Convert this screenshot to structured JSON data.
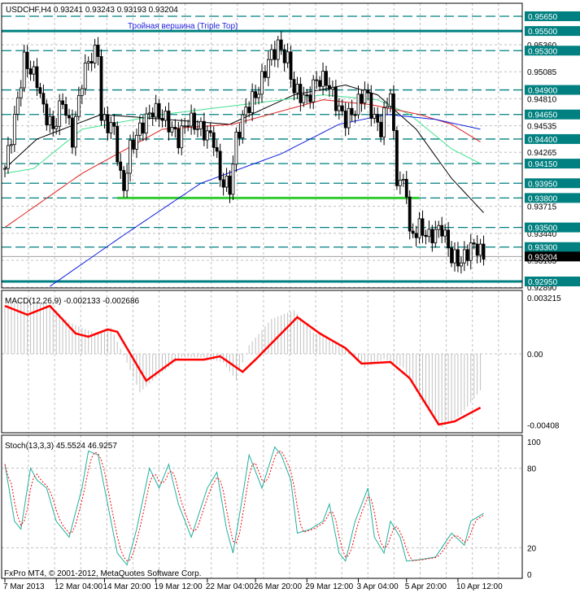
{
  "header": {
    "symbol_info": "USDCHF,H4  0.93241 0.93243 0.93193 0.93204",
    "pattern_label": "Тройная вершина (Triple Top)"
  },
  "colors": {
    "level": "#008080",
    "support": "#33cc33",
    "ma_black": "#000000",
    "ma_red": "#e02020",
    "ma_blue": "#1020e0",
    "ma_green": "#40e090",
    "macd_signal": "#ff0000",
    "macd_hist": "#c0c0c0",
    "stoch_main": "#20b0a0",
    "stoch_signal": "#ff0000"
  },
  "footer": {
    "copyright": "FxPro MT4, © 2001-2012, MetaQuotes Software Corp."
  },
  "chart_data": [
    {
      "type": "candlestick",
      "title": "USDCHF,H4",
      "ylim": [
        0.9287,
        0.9578
      ],
      "x_tick_labels": [
        "7 Mar 2013",
        "12 Mar 04:00",
        "14 Mar 20:00",
        "19 Mar 12:00",
        "22 Mar 04:00",
        "26 Mar 20:00",
        "29 Mar 12:00",
        "3 Apr 04:00",
        "5 Apr 20:00",
        "10 Apr 12:00"
      ],
      "x_tick_bars": [
        0,
        16,
        31,
        47,
        63,
        78,
        94,
        110,
        125,
        141
      ],
      "y_tick_labels": [
        "0.95360",
        "0.95085",
        "0.94810",
        "0.94535",
        "0.94265",
        "0.93715",
        "0.93440",
        "0.93165",
        "0.92890"
      ],
      "levels": [
        {
          "label": "0.95650",
          "price": 0.9565,
          "style": "dashed"
        },
        {
          "label": "0.95500",
          "price": 0.955,
          "style": "solid"
        },
        {
          "label": "0.95300",
          "price": 0.953,
          "style": "dashed"
        },
        {
          "label": "0.94900",
          "price": 0.949,
          "style": "dashed"
        },
        {
          "label": "0.94650",
          "price": 0.9465,
          "style": "dashed"
        },
        {
          "label": "0.94400",
          "price": 0.944,
          "style": "dashed"
        },
        {
          "label": "0.94150",
          "price": 0.9415,
          "style": "dashed"
        },
        {
          "label": "0.93950",
          "price": 0.9395,
          "style": "dashed"
        },
        {
          "label": "0.93800",
          "price": 0.938,
          "style": "dashed"
        },
        {
          "label": "0.93500",
          "price": 0.935,
          "style": "dashed"
        },
        {
          "label": "0.93300",
          "price": 0.933,
          "style": "dashed"
        },
        {
          "label": "0.92950",
          "price": 0.9295,
          "style": "solid"
        }
      ],
      "support_line": {
        "price": 0.938,
        "from_bar": 35,
        "to_bar": 129
      },
      "current_price": {
        "label": "0.93204",
        "price": 0.93204
      },
      "close_path": [
        [
          0,
          0.941
        ],
        [
          3,
          0.946
        ],
        [
          6,
          0.952
        ],
        [
          10,
          0.95
        ],
        [
          12,
          0.947
        ],
        [
          15,
          0.945
        ],
        [
          18,
          0.948
        ],
        [
          21,
          0.944
        ],
        [
          24,
          0.95
        ],
        [
          26,
          0.952
        ],
        [
          29,
          0.953
        ],
        [
          30,
          0.946
        ],
        [
          34,
          0.945
        ],
        [
          36,
          0.94
        ],
        [
          37,
          0.939
        ],
        [
          39,
          0.943
        ],
        [
          42,
          0.945
        ],
        [
          46,
          0.947
        ],
        [
          50,
          0.946
        ],
        [
          54,
          0.944
        ],
        [
          57,
          0.946
        ],
        [
          61,
          0.945
        ],
        [
          65,
          0.944
        ],
        [
          67,
          0.94
        ],
        [
          70,
          0.939
        ],
        [
          72,
          0.944
        ],
        [
          75,
          0.947
        ],
        [
          79,
          0.949
        ],
        [
          82,
          0.952
        ],
        [
          85,
          0.9535
        ],
        [
          88,
          0.952
        ],
        [
          90,
          0.949
        ],
        [
          94,
          0.948
        ],
        [
          97,
          0.95
        ],
        [
          100,
          0.95
        ],
        [
          104,
          0.947
        ],
        [
          106,
          0.946
        ],
        [
          109,
          0.947
        ],
        [
          112,
          0.949
        ],
        [
          115,
          0.946
        ],
        [
          117,
          0.945
        ],
        [
          120,
          0.949
        ],
        [
          121,
          0.944
        ],
        [
          122,
          0.94
        ],
        [
          125,
          0.939
        ],
        [
          126,
          0.934
        ],
        [
          129,
          0.935
        ],
        [
          132,
          0.934
        ],
        [
          136,
          0.935
        ],
        [
          139,
          0.932
        ],
        [
          142,
          0.9315
        ],
        [
          145,
          0.933
        ],
        [
          147,
          0.933
        ],
        [
          149,
          0.932
        ]
      ],
      "moving_averages": [
        {
          "name": "ma_black",
          "points": [
            [
              0,
              0.941
            ],
            [
              10,
              0.944
            ],
            [
              30,
              0.9465
            ],
            [
              50,
              0.946
            ],
            [
              70,
              0.9455
            ],
            [
              90,
              0.9485
            ],
            [
              106,
              0.9495
            ],
            [
              116,
              0.9485
            ],
            [
              128,
              0.945
            ],
            [
              139,
              0.94
            ],
            [
              149,
              0.9365
            ]
          ]
        },
        {
          "name": "ma_green",
          "points": [
            [
              0,
              0.9405
            ],
            [
              9,
              0.941
            ],
            [
              24,
              0.945
            ],
            [
              49,
              0.9465
            ],
            [
              74,
              0.9475
            ],
            [
              99,
              0.9485
            ],
            [
              116,
              0.948
            ],
            [
              126,
              0.9465
            ],
            [
              139,
              0.943
            ],
            [
              148,
              0.9415
            ]
          ]
        },
        {
          "name": "ma_red",
          "points": [
            [
              0,
              0.935
            ],
            [
              24,
              0.9405
            ],
            [
              49,
              0.945
            ],
            [
              71,
              0.9455
            ],
            [
              99,
              0.948
            ],
            [
              114,
              0.9475
            ],
            [
              129,
              0.9465
            ],
            [
              139,
              0.9455
            ],
            [
              148,
              0.9437
            ]
          ]
        },
        {
          "name": "ma_blue",
          "points": [
            [
              14,
              0.929
            ],
            [
              36,
              0.934
            ],
            [
              61,
              0.9395
            ],
            [
              86,
              0.9425
            ],
            [
              104,
              0.9455
            ],
            [
              119,
              0.9465
            ],
            [
              134,
              0.946
            ],
            [
              148,
              0.945
            ]
          ]
        }
      ]
    },
    {
      "type": "bar+line",
      "title": "MACD(12,26,9) -0.002133 -0.002686",
      "ylim": [
        -0.0043,
        0.0034
      ],
      "y_tick_labels": [
        "0.003215",
        "0.00",
        "-0.00408"
      ],
      "histogram": [
        [
          0,
          0.0028
        ],
        [
          5,
          0.003
        ],
        [
          10,
          0.003
        ],
        [
          14,
          0.0028
        ],
        [
          20,
          0.0018
        ],
        [
          28,
          0.0012
        ],
        [
          33,
          0.0015
        ],
        [
          38,
          -0.0005
        ],
        [
          42,
          -0.0022
        ],
        [
          48,
          -0.0012
        ],
        [
          55,
          -0.0002
        ],
        [
          62,
          -0.0002
        ],
        [
          68,
          -0.0005
        ],
        [
          72,
          -0.0015
        ],
        [
          76,
          0.0005
        ],
        [
          83,
          0.002
        ],
        [
          90,
          0.0025
        ],
        [
          96,
          0.0012
        ],
        [
          102,
          0.0008
        ],
        [
          108,
          0.0
        ],
        [
          112,
          -0.0008
        ],
        [
          118,
          -0.0003
        ],
        [
          124,
          -0.0008
        ],
        [
          130,
          -0.0028
        ],
        [
          136,
          -0.0042
        ],
        [
          142,
          -0.0035
        ],
        [
          148,
          -0.0021
        ]
      ],
      "signal": [
        [
          0,
          0.00275
        ],
        [
          7,
          0.00224
        ],
        [
          14,
          0.00275
        ],
        [
          22,
          0.00117
        ],
        [
          26,
          0.00098
        ],
        [
          32,
          0.0014
        ],
        [
          35,
          0.00126
        ],
        [
          44,
          -0.00154
        ],
        [
          53,
          -0.00033
        ],
        [
          62,
          -0.00033
        ],
        [
          67,
          -0.00014
        ],
        [
          74,
          -0.00103
        ],
        [
          78,
          -0.00033
        ],
        [
          91,
          0.0021
        ],
        [
          98,
          0.00117
        ],
        [
          106,
          0.00033
        ],
        [
          111,
          -0.00056
        ],
        [
          120,
          -0.00047
        ],
        [
          126,
          -0.0014
        ],
        [
          135,
          -0.00405
        ],
        [
          140,
          -0.00387
        ],
        [
          148,
          -0.00308
        ]
      ]
    },
    {
      "type": "line",
      "title": "Stoch(13,3,3) 45.5524 46.9257",
      "ylim": [
        0,
        100
      ],
      "y_tick_labels": [
        "100",
        "80",
        "20",
        "0"
      ],
      "main": [
        [
          0,
          83
        ],
        [
          3,
          40
        ],
        [
          5,
          34
        ],
        [
          8,
          80
        ],
        [
          10,
          71
        ],
        [
          13,
          65
        ],
        [
          16,
          40
        ],
        [
          20,
          28
        ],
        [
          24,
          65
        ],
        [
          26,
          93
        ],
        [
          29,
          90
        ],
        [
          31,
          65
        ],
        [
          35,
          16
        ],
        [
          38,
          7
        ],
        [
          41,
          34
        ],
        [
          45,
          80
        ],
        [
          48,
          65
        ],
        [
          51,
          83
        ],
        [
          54,
          53
        ],
        [
          58,
          28
        ],
        [
          63,
          65
        ],
        [
          66,
          77
        ],
        [
          69,
          34
        ],
        [
          71,
          16
        ],
        [
          74,
          59
        ],
        [
          76,
          90
        ],
        [
          80,
          65
        ],
        [
          84,
          96
        ],
        [
          86,
          90
        ],
        [
          89,
          71
        ],
        [
          91,
          31
        ],
        [
          95,
          34
        ],
        [
          99,
          40
        ],
        [
          101,
          53
        ],
        [
          104,
          16
        ],
        [
          106,
          10
        ],
        [
          109,
          40
        ],
        [
          113,
          65
        ],
        [
          115,
          28
        ],
        [
          118,
          16
        ],
        [
          120,
          40
        ],
        [
          123,
          28
        ],
        [
          125,
          10
        ],
        [
          129,
          11
        ],
        [
          134,
          13
        ],
        [
          139,
          31
        ],
        [
          143,
          22
        ],
        [
          145,
          40
        ],
        [
          149,
          46
        ]
      ]
    }
  ]
}
